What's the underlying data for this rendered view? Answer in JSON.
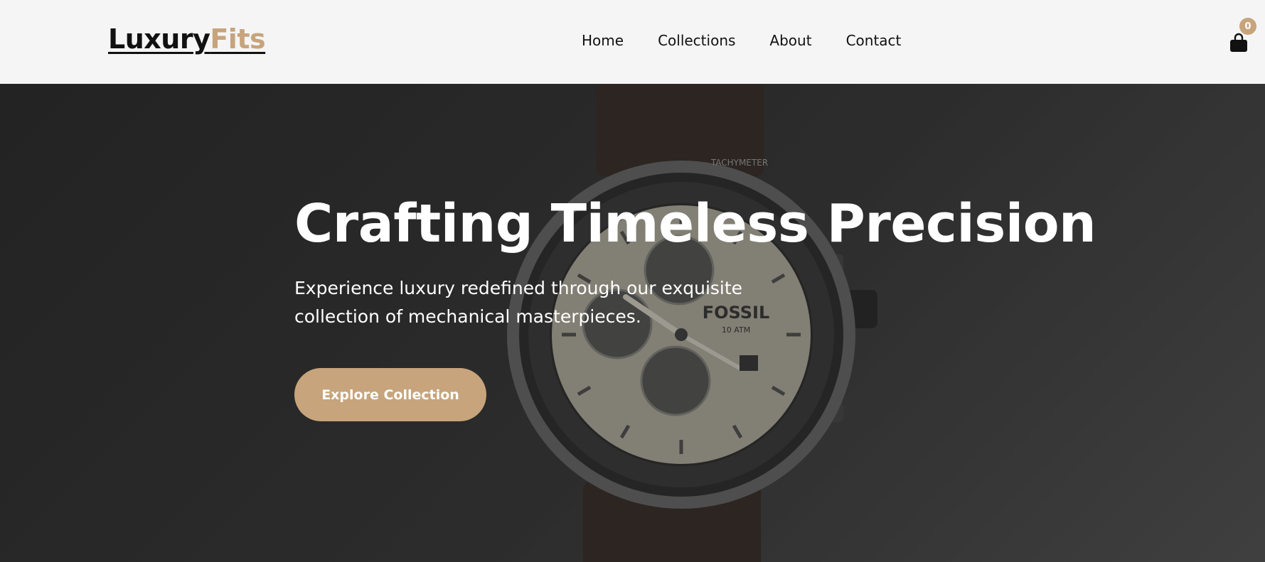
{
  "header": {
    "logo": {
      "primary": "Luxury",
      "accent": "Fits"
    },
    "nav": [
      {
        "label": "Home"
      },
      {
        "label": "Collections"
      },
      {
        "label": "About"
      },
      {
        "label": "Contact"
      }
    ],
    "cart": {
      "count": "0",
      "icon": "shopping-bag-icon"
    }
  },
  "hero": {
    "title": "Crafting Timeless Precision",
    "subtitle": "Experience luxury redefined through our exquisite collection of mechanical masterpieces.",
    "cta_label": "Explore Collection",
    "watch": {
      "brand": "FOSSIL",
      "rating": "10 ATM",
      "bezel_label": "TACHYMETER"
    }
  },
  "colors": {
    "accent": "#c7a47c",
    "header_bg": "#f5f5f5",
    "text_dark": "#111111",
    "hero_text": "#ffffff"
  }
}
